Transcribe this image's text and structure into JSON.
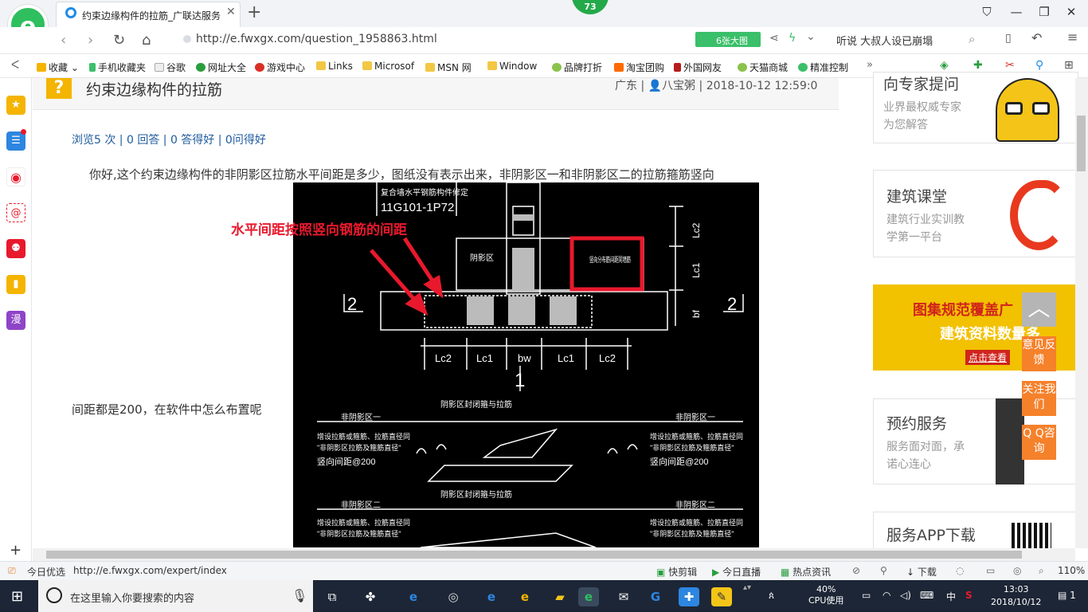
{
  "browser": {
    "tab_title": "约束边缘构件的拉筋_广联达服务",
    "notification_count": "73",
    "url": "http://e.fwxgx.com/question_1958863.html",
    "big_pic_label": "6张大图",
    "hot_search": "听说 大叔人设已崩塌",
    "bookmarks": [
      "收藏",
      "手机收藏夹",
      "谷歌",
      "网址大全",
      "游戏中心",
      "Links",
      "Microsof",
      "MSN 网",
      "Window",
      "品牌打折",
      "淘宝团购",
      "外国网友",
      "天猫商城",
      "精准控制"
    ]
  },
  "question": {
    "title": "约束边缘构件的拉筋",
    "region": "广东",
    "author": "八宝粥",
    "datetime": "2018-10-12 12:59:0",
    "stats": "浏览5 次 | 0 回答 | 0 答得好 | 0问得好",
    "body_line1": "你好,这个约束边缘构件的非阴影区拉筋水平间距是多少，图纸没有表示出来，非阴影区一和非阴影区二的拉筋箍筋竖向",
    "body_line2": "间距都是200，在软件中怎么布置呢"
  },
  "drawing": {
    "annotation": "水平间距按照竖向钢筋的间距",
    "top_caption": "复合墙水平钢筋构件修定",
    "ref": "11G101-1P72",
    "section_label": "2",
    "axis_label": "1",
    "labels": [
      "Lc2",
      "Lc1",
      "bw",
      "Lc1",
      "Lc2"
    ],
    "right_labels": [
      "Lc2",
      "Lc1",
      "bf"
    ],
    "yin_label": "阴影区",
    "boxed_text": "竖向分布筋间距同墙筋",
    "zone1": "非阴影区一",
    "zone2": "非阴影区二",
    "yin_detail": "阴影区封闭箍与拉筋",
    "note1": "增设拉筋或箍筋、拉筋直径同",
    "note2": "\"非阴影区拉筋及箍筋直径\"",
    "spacing": "竖向间距@200"
  },
  "sidebar_right": {
    "expert_title": "向专家提问",
    "expert_sub": [
      "业界最权威专家",
      "为您解答"
    ],
    "course_title": "建筑课堂",
    "course_sub": [
      "建筑行业实训教",
      "学第一平台"
    ],
    "banner_line1": "图集规范覆盖广",
    "banner_line2": "建筑资料数量多",
    "banner_cta": "点击查看",
    "service_title": "预约服务",
    "service_sub": [
      "服务面对面，承",
      "诺心连心"
    ],
    "app_title": "服务APP下载",
    "float_feedback": "意见反馈",
    "float_follow": "关注我们",
    "float_qq": "Q Q咨询"
  },
  "statusbar": {
    "today": "今日优选",
    "link": "http://e.fwxgx.com/expert/index",
    "items": [
      "快剪辑",
      "今日直播",
      "热点资讯",
      "下载"
    ],
    "zoom": "110%"
  },
  "taskbar": {
    "search_placeholder": "在这里输入你要搜索的内容",
    "cpu_pct": "40%",
    "cpu_label": "CPU使用",
    "ime": "中",
    "time": "13:03",
    "date": "2018/10/12",
    "notif": "1"
  }
}
